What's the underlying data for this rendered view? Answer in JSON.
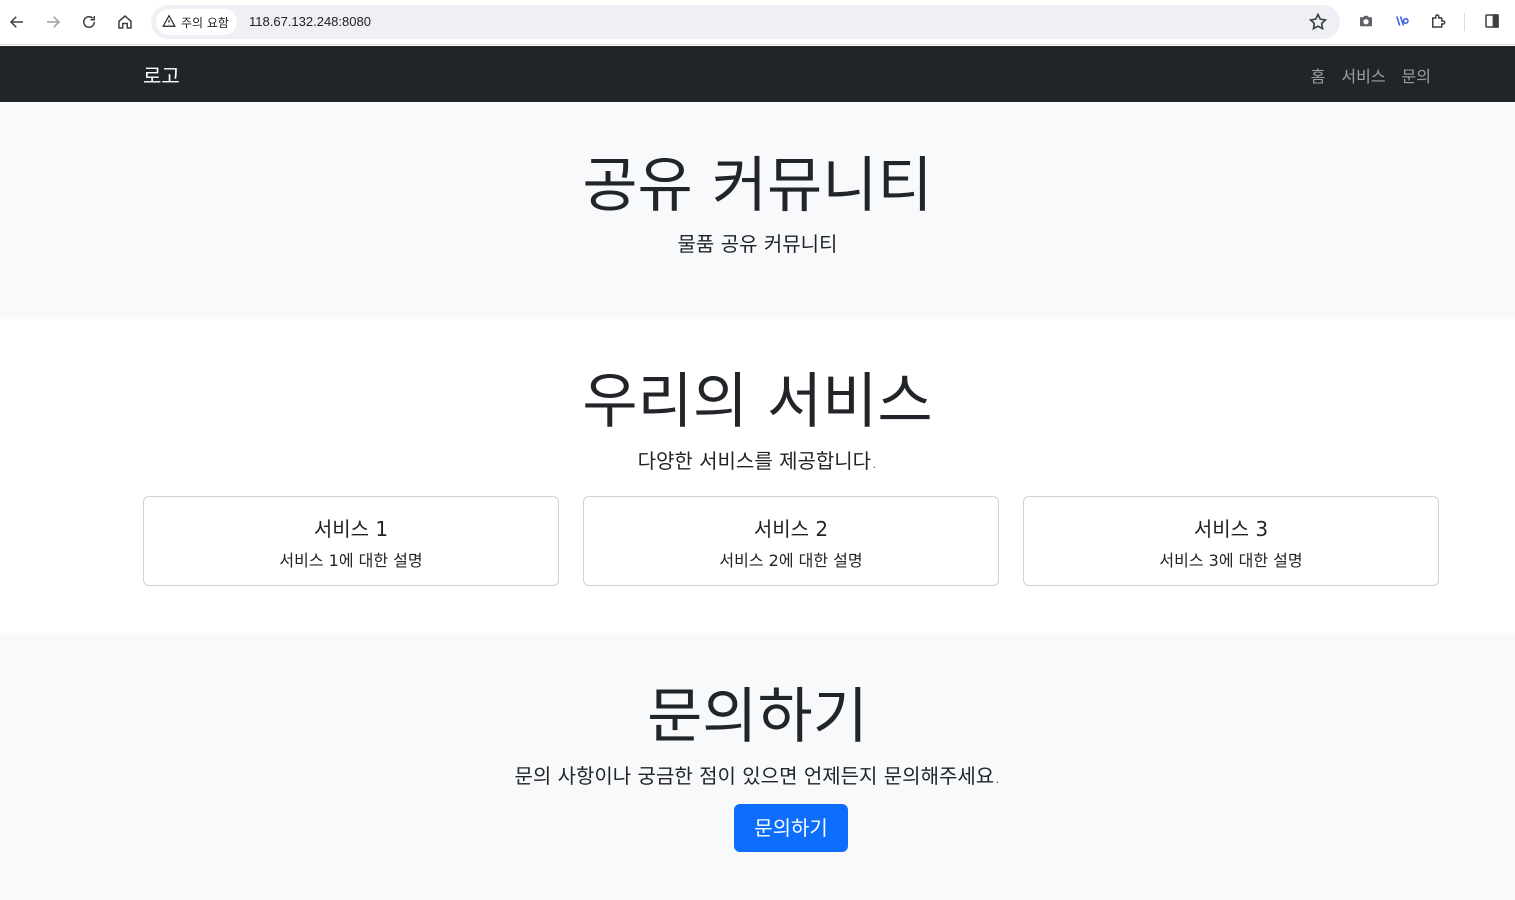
{
  "browser": {
    "security_label": "주의 요함",
    "url": "118.67.132.248:8080",
    "icons": [
      "back-arrow-icon",
      "forward-arrow-icon",
      "reload-icon",
      "home-icon",
      "warning-icon",
      "star-icon",
      "camera-icon",
      "extension-icon",
      "puzzle-icon",
      "side-panel-icon"
    ]
  },
  "navbar": {
    "brand": "로고",
    "links": [
      {
        "label": "홈"
      },
      {
        "label": "서비스"
      },
      {
        "label": "문의"
      }
    ]
  },
  "hero": {
    "title": "공유 커뮤니티",
    "subtitle": "물품 공유 커뮤니티"
  },
  "services": {
    "title": "우리의 서비스",
    "subtitle": "다양한 서비스를 제공합니다.",
    "cards": [
      {
        "title": "서비스 1",
        "text": "서비스 1에 대한 설명"
      },
      {
        "title": "서비스 2",
        "text": "서비스 2에 대한 설명"
      },
      {
        "title": "서비스 3",
        "text": "서비스 3에 대한 설명"
      }
    ]
  },
  "contact": {
    "title": "문의하기",
    "subtitle": "문의 사항이나 궁금한 점이 있으면 언제든지 문의해주세요.",
    "button": "문의하기"
  },
  "colors": {
    "navbar_bg": "#212529",
    "section_light_bg": "#f8f9fa",
    "primary_button": "#0d6efd"
  }
}
